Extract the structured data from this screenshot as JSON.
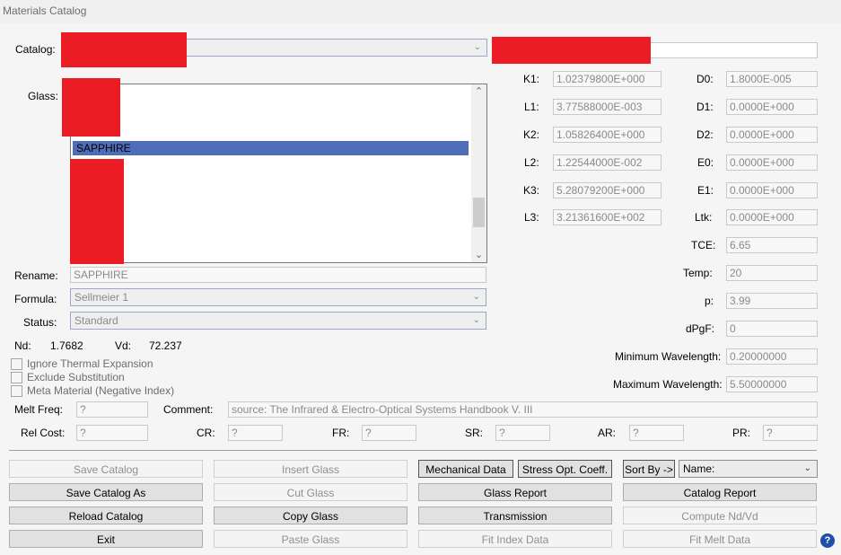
{
  "window": {
    "title": "Materials Catalog"
  },
  "catalog": {
    "label": "Catalog:"
  },
  "glass": {
    "label": "Glass:",
    "selected": "SAPPHIRE"
  },
  "rename": {
    "label": "Rename:",
    "value": "SAPPHIRE"
  },
  "formula": {
    "label": "Formula:",
    "value": "Sellmeier 1"
  },
  "status": {
    "label": "Status:",
    "value": "Standard"
  },
  "nd": {
    "label": "Nd:",
    "value": "1.7682"
  },
  "vd": {
    "label": "Vd:",
    "value": "72.237"
  },
  "checks": {
    "ignore_thermal": "Ignore Thermal Expansion",
    "exclude_sub": "Exclude Substitution",
    "meta_material": "Meta Material (Negative Index)"
  },
  "coeffs": {
    "K1": {
      "label": "K1:",
      "value": "1.02379800E+000"
    },
    "L1": {
      "label": "L1:",
      "value": "3.77588000E-003"
    },
    "K2": {
      "label": "K2:",
      "value": "1.05826400E+000"
    },
    "L2": {
      "label": "L2:",
      "value": "1.22544000E-002"
    },
    "K3": {
      "label": "K3:",
      "value": "5.28079200E+000"
    },
    "L3": {
      "label": "L3:",
      "value": "3.21361600E+002"
    },
    "D0": {
      "label": "D0:",
      "value": "1.8000E-005"
    },
    "D1": {
      "label": "D1:",
      "value": "0.0000E+000"
    },
    "D2": {
      "label": "D2:",
      "value": "0.0000E+000"
    },
    "E0": {
      "label": "E0:",
      "value": "0.0000E+000"
    },
    "E1": {
      "label": "E1:",
      "value": "0.0000E+000"
    },
    "Ltk": {
      "label": "Ltk:",
      "value": "0.0000E+000"
    },
    "TCE": {
      "label": "TCE:",
      "value": "6.65"
    },
    "Temp": {
      "label": "Temp:",
      "value": "20"
    },
    "p": {
      "label": "p:",
      "value": "3.99"
    },
    "dPgF": {
      "label": "dPgF:",
      "value": "0"
    },
    "min_wl": {
      "label": "Minimum Wavelength:",
      "value": "0.20000000"
    },
    "max_wl": {
      "label": "Maximum Wavelength:",
      "value": "5.50000000"
    }
  },
  "melt_freq": {
    "label": "Melt Freq:",
    "value": "?"
  },
  "comment": {
    "label": "Comment:",
    "value": "source:  The Infrared & Electro-Optical Systems Handbook V. III"
  },
  "costs": {
    "rel_cost": {
      "label": "Rel Cost:",
      "value": "?"
    },
    "cr": {
      "label": "CR:",
      "value": "?"
    },
    "fr": {
      "label": "FR:",
      "value": "?"
    },
    "sr": {
      "label": "SR:",
      "value": "?"
    },
    "ar": {
      "label": "AR:",
      "value": "?"
    },
    "pr": {
      "label": "PR:",
      "value": "?"
    }
  },
  "buttons": {
    "save_catalog": "Save Catalog",
    "save_catalog_as": "Save Catalog As",
    "reload_catalog": "Reload Catalog",
    "exit": "Exit",
    "insert_glass": "Insert Glass",
    "cut_glass": "Cut Glass",
    "copy_glass": "Copy Glass",
    "paste_glass": "Paste Glass",
    "mechanical_data": "Mechanical Data",
    "stress_opt": "Stress Opt. Coeff.",
    "glass_report": "Glass Report",
    "transmission": "Transmission",
    "fit_index": "Fit Index Data",
    "sort_by": "Sort By ->",
    "catalog_report": "Catalog Report",
    "compute_nd_vd": "Compute Nd/Vd",
    "fit_melt": "Fit Melt Data"
  },
  "sort": {
    "value": "Name:"
  },
  "help": {
    "glyph": "?"
  }
}
